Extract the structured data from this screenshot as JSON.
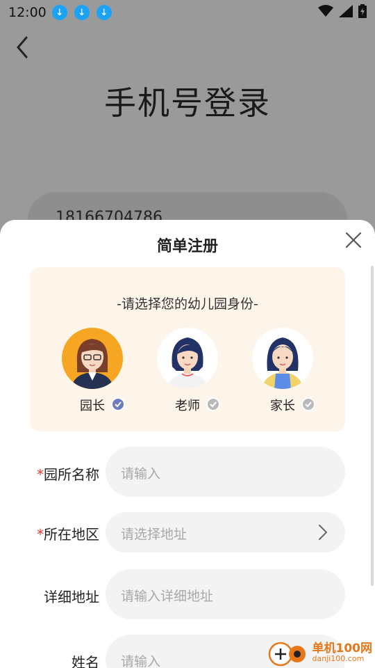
{
  "status_bar": {
    "time": "12:00",
    "download_icons": [
      "download-icon",
      "download-icon",
      "download-icon"
    ]
  },
  "page": {
    "title": "手机号登录",
    "phone_value": "18166704786"
  },
  "sheet": {
    "title": "简单注册",
    "role_hint": "-请选择您的幼儿园身份-",
    "roles": [
      {
        "label": "园长",
        "selected": true
      },
      {
        "label": "老师",
        "selected": false
      },
      {
        "label": "家长",
        "selected": false
      }
    ],
    "fields": [
      {
        "label": "园所名称",
        "required": "*",
        "placeholder": "请输入"
      },
      {
        "label": "所在地区",
        "required": "*",
        "placeholder": "请选择地址"
      },
      {
        "label": "详细地址",
        "required": "",
        "placeholder": "请输入详细地址"
      },
      {
        "label": "姓名",
        "required": "",
        "placeholder": "请输入"
      }
    ]
  },
  "watermark": {
    "cn": "单机100网",
    "en": "danji100.com"
  },
  "colors": {
    "accent_download": "#1aa3f5",
    "role_card_bg": "#fdf5ea",
    "required": "#e53935",
    "check_selected": "#6c7bbf",
    "check_unselected": "#b9b9b9"
  }
}
